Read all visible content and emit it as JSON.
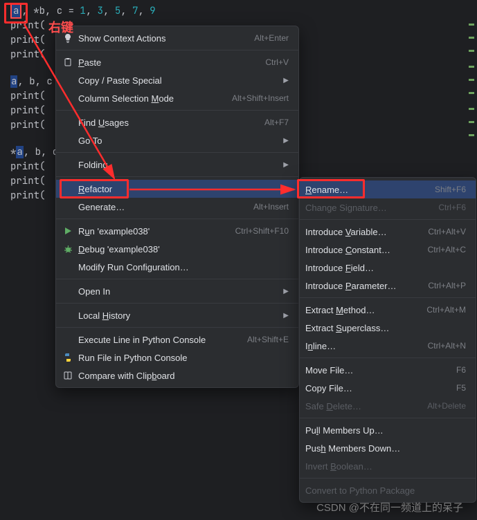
{
  "annotation_rightclick": "右键",
  "code": {
    "line1_pre": ", *b, c = ",
    "nums": [
      "1",
      "3",
      "5",
      "7",
      "9"
    ],
    "print_stub": "print(",
    "line_assign2": "a, b, c",
    "line_assign3": "*a, b, c"
  },
  "menu": {
    "show_context_actions": "Show Context Actions",
    "show_context_actions_sc": "Alt+Enter",
    "paste": "Paste",
    "paste_sc": "Ctrl+V",
    "copy_paste_special": "Copy / Paste Special",
    "column_selection_mode": "Column Selection Mode",
    "column_selection_mode_sc": "Alt+Shift+Insert",
    "find_usages": "Find Usages",
    "find_usages_sc": "Alt+F7",
    "goto": "Go To",
    "folding": "Folding",
    "refactor": "Refactor",
    "generate": "Generate…",
    "generate_sc": "Alt+Insert",
    "run": "Run 'example038'",
    "run_sc": "Ctrl+Shift+F10",
    "debug": "Debug 'example038'",
    "modify_run": "Modify Run Configuration…",
    "open_in": "Open In",
    "local_history": "Local History",
    "execute_line": "Execute Line in Python Console",
    "execute_line_sc": "Alt+Shift+E",
    "run_file": "Run File in Python Console",
    "compare_clipboard": "Compare with Clipboard"
  },
  "submenu": {
    "rename": "Rename…",
    "rename_sc": "Shift+F6",
    "change_signature": "Change Signature…",
    "change_signature_sc": "Ctrl+F6",
    "introduce_variable": "Introduce Variable…",
    "introduce_variable_sc": "Ctrl+Alt+V",
    "introduce_constant": "Introduce Constant…",
    "introduce_constant_sc": "Ctrl+Alt+C",
    "introduce_field": "Introduce Field…",
    "introduce_parameter": "Introduce Parameter…",
    "introduce_parameter_sc": "Ctrl+Alt+P",
    "extract_method": "Extract Method…",
    "extract_method_sc": "Ctrl+Alt+M",
    "extract_superclass": "Extract Superclass…",
    "inline": "Inline…",
    "inline_sc": "Ctrl+Alt+N",
    "move_file": "Move File…",
    "move_file_sc": "F6",
    "copy_file": "Copy File…",
    "copy_file_sc": "F5",
    "safe_delete": "Safe Delete…",
    "safe_delete_sc": "Alt+Delete",
    "pull_up": "Pull Members Up…",
    "push_down": "Push Members Down…",
    "invert_boolean": "Invert Boolean…",
    "convert_package": "Convert to Python Package"
  },
  "watermark": "CSDN @不在同一频道上的呆子"
}
